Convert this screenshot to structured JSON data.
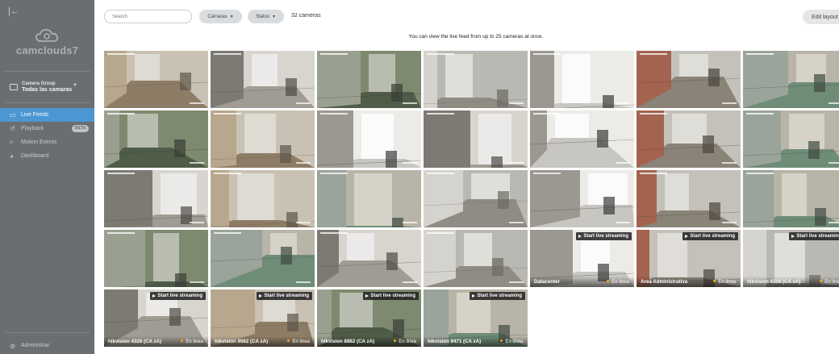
{
  "sidebar": {
    "logo_text": "camclouds7",
    "group": {
      "title": "Camera Group",
      "value": "Todas las camaras"
    },
    "nav": [
      {
        "key": "live-feeds",
        "label": "Live Feeds",
        "active": true,
        "icon": "monitor-icon"
      },
      {
        "key": "playback",
        "label": "Playback",
        "badge": "BETA",
        "icon": "history-icon"
      },
      {
        "key": "motion-events",
        "label": "Motion Events",
        "icon": "motion-icon"
      },
      {
        "key": "dashboard",
        "label": "Dashboard",
        "icon": "dashboard-icon"
      }
    ],
    "admin_label": "Administrar"
  },
  "toolbar": {
    "search_placeholder": "Search",
    "cameras_filter": "Cámaras",
    "status_filter": "Status",
    "camera_count": "32 cameras",
    "edit_layout": "Edit layout"
  },
  "info_text": "You can view the live feed from up to 25 cameras at once.",
  "live_button_label": "Start live streaming",
  "status_label": "En linea",
  "tiles": [
    {
      "name": "",
      "live": false,
      "scene": "A"
    },
    {
      "name": "",
      "live": false,
      "scene": "B"
    },
    {
      "name": "",
      "live": false,
      "scene": "C"
    },
    {
      "name": "",
      "live": false,
      "scene": "D"
    },
    {
      "name": "",
      "live": false,
      "scene": "E"
    },
    {
      "name": "",
      "live": false,
      "scene": "F"
    },
    {
      "name": "",
      "live": false,
      "scene": "G"
    },
    {
      "name": "",
      "live": false,
      "scene": "C"
    },
    {
      "name": "",
      "live": false,
      "scene": "A"
    },
    {
      "name": "",
      "live": false,
      "scene": "E"
    },
    {
      "name": "",
      "live": false,
      "scene": "B"
    },
    {
      "name": "",
      "live": false,
      "scene": "E"
    },
    {
      "name": "",
      "live": false,
      "scene": "F"
    },
    {
      "name": "",
      "live": false,
      "scene": "G"
    },
    {
      "name": "",
      "live": false,
      "scene": "B"
    },
    {
      "name": "",
      "live": false,
      "scene": "A"
    },
    {
      "name": "",
      "live": false,
      "scene": "G"
    },
    {
      "name": "",
      "live": false,
      "scene": "D"
    },
    {
      "name": "",
      "live": false,
      "scene": "E"
    },
    {
      "name": "",
      "live": false,
      "scene": "F"
    },
    {
      "name": "",
      "live": false,
      "scene": "G"
    },
    {
      "name": "",
      "live": false,
      "scene": "C"
    },
    {
      "name": "",
      "live": false,
      "scene": "G"
    },
    {
      "name": "",
      "live": false,
      "scene": "B"
    },
    {
      "name": "",
      "live": false,
      "scene": "D"
    },
    {
      "name": "Datacenter",
      "live": true,
      "scene": "E"
    },
    {
      "name": "Area Administrativa",
      "live": true,
      "scene": "F"
    },
    {
      "name": "hikvision 4316 (CA zA)",
      "live": true,
      "scene": "D"
    },
    {
      "name": "hikvision 4326 (CA zA)",
      "live": true,
      "scene": "B"
    },
    {
      "name": "hikvision 9562 (CA zA)",
      "live": true,
      "scene": "A"
    },
    {
      "name": "hikvision 8882 (CA zA)",
      "live": true,
      "scene": "C"
    },
    {
      "name": "hikvision 9471 (CA zA)",
      "live": true,
      "scene": "G"
    }
  ],
  "colors": {
    "accent": "#4b97d3",
    "sidebar": "#6b6e70",
    "status_dot": "#f5a623"
  }
}
